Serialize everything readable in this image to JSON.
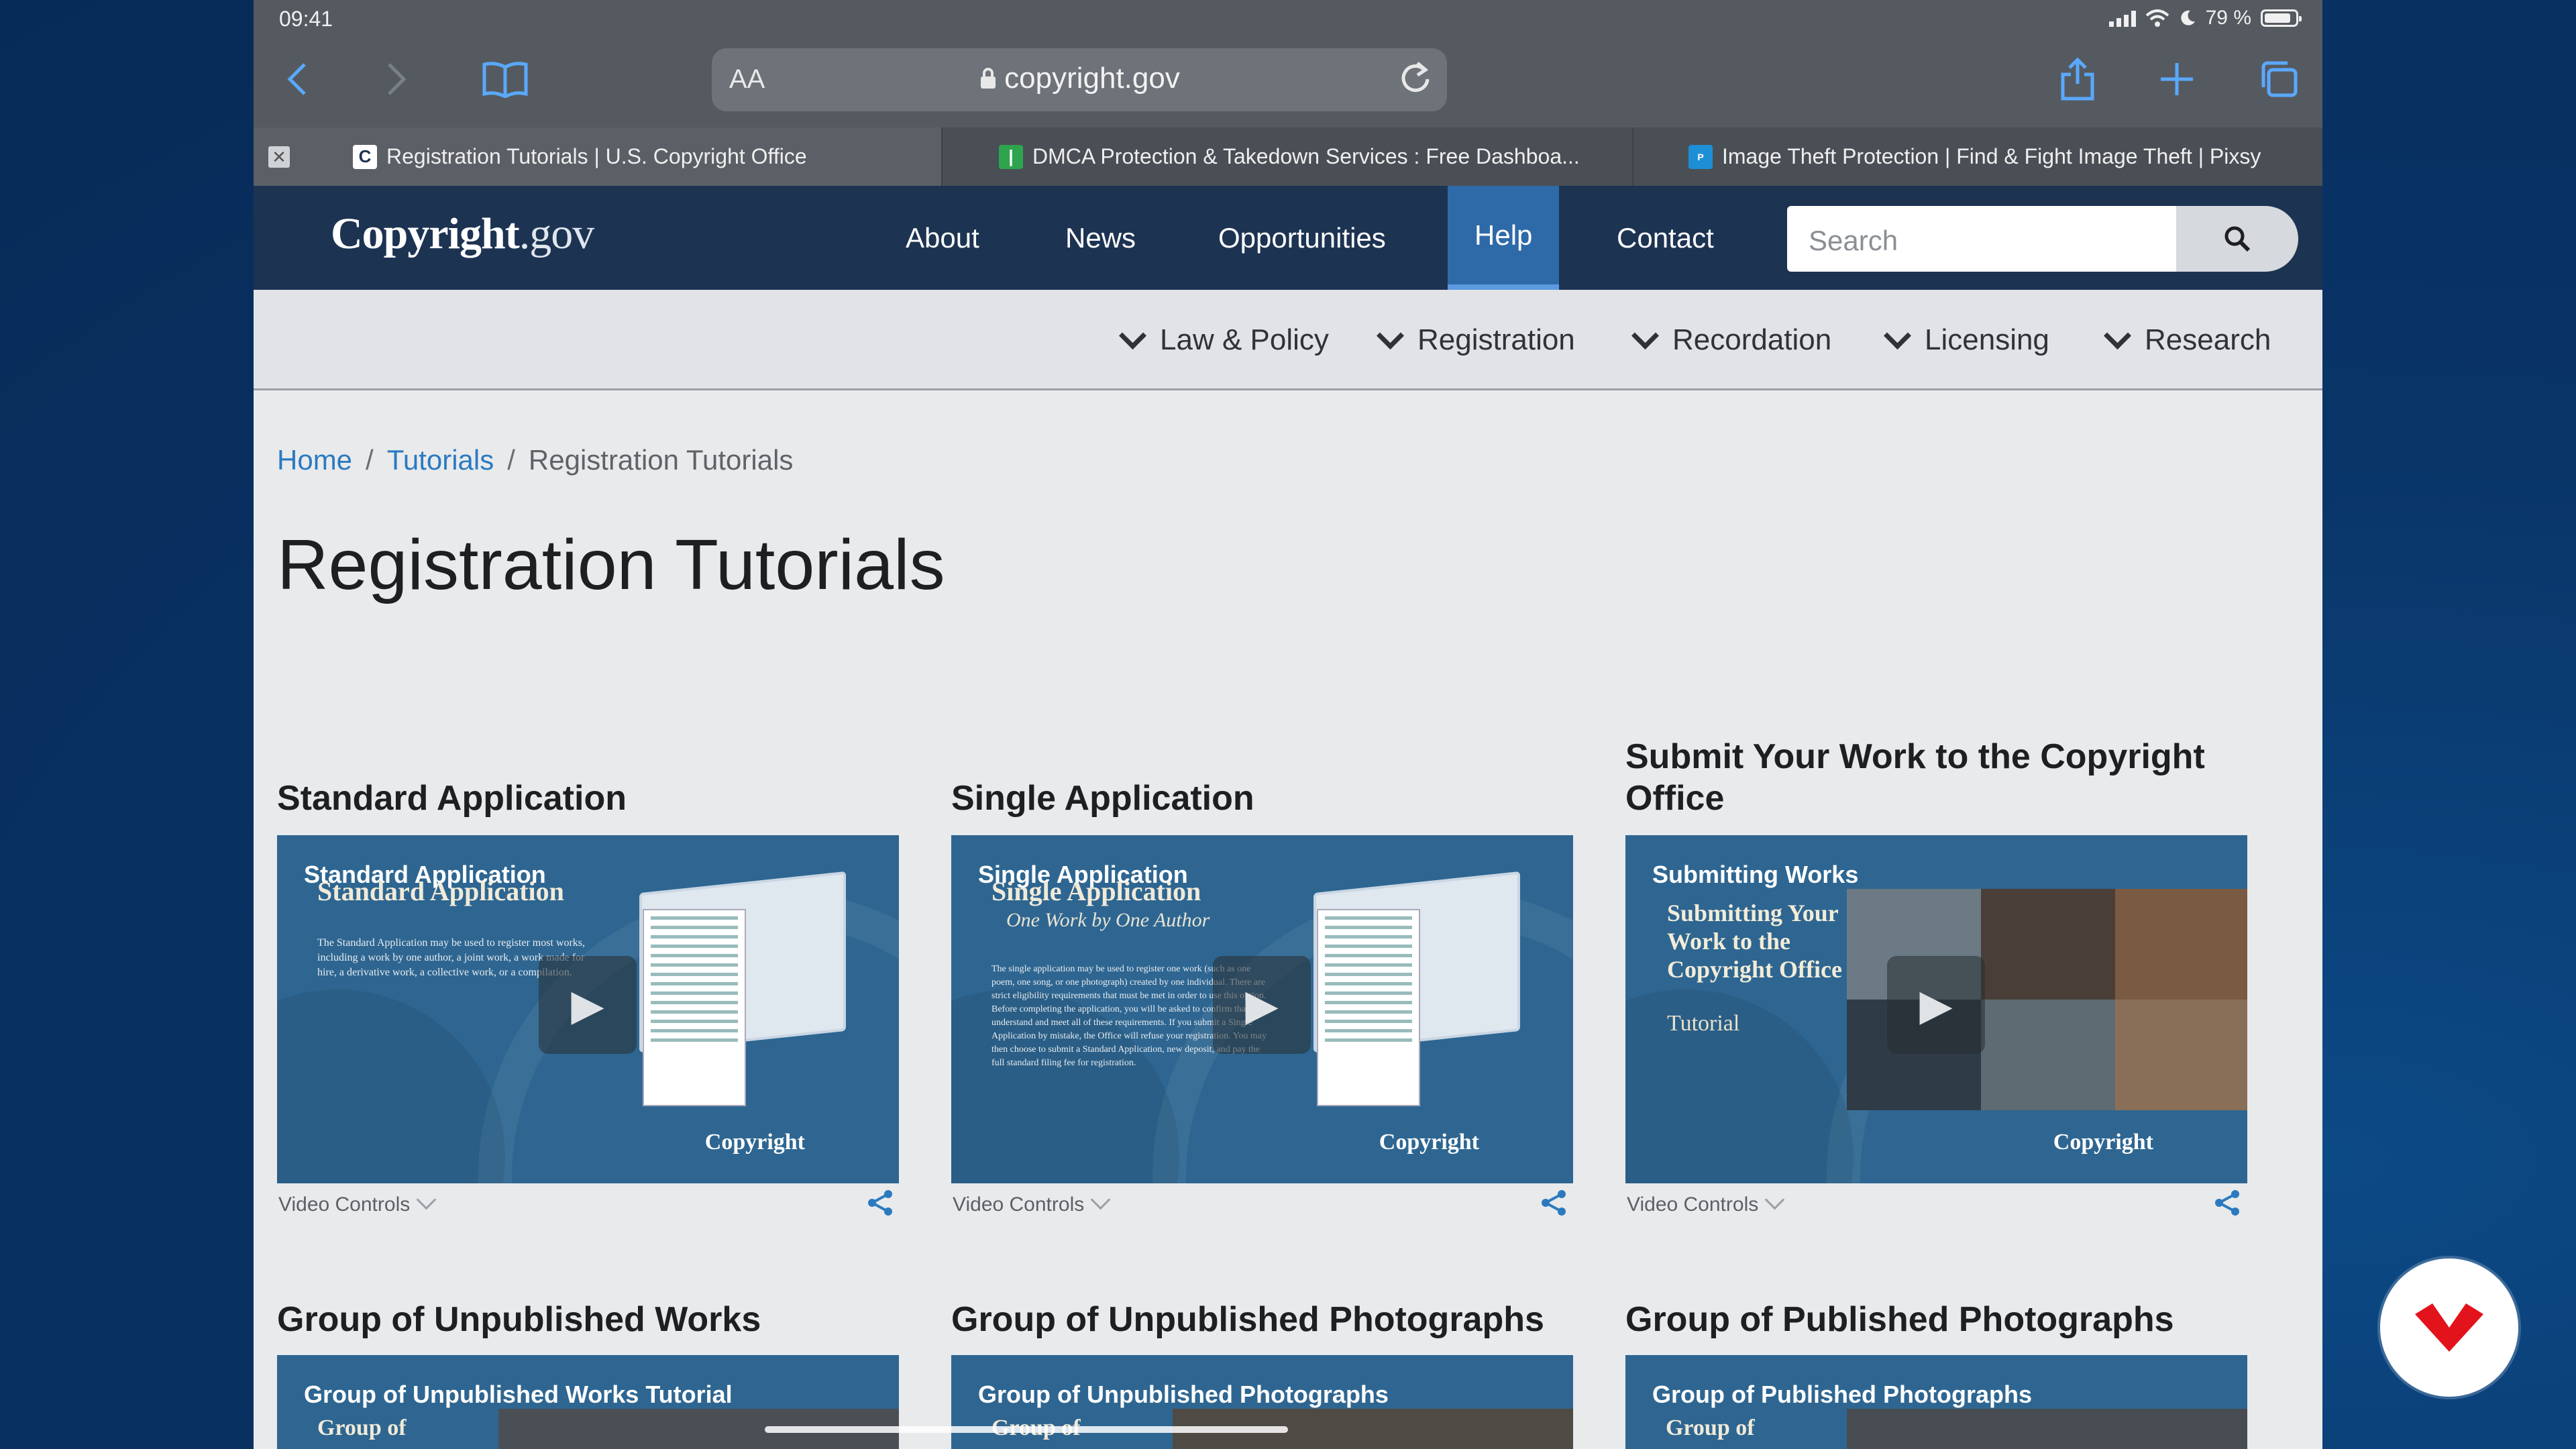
{
  "status": {
    "time": "09:41",
    "battery": "79 %"
  },
  "browser": {
    "url_aa": "AA",
    "url": "copyright.gov",
    "tabs": [
      {
        "title": "Registration Tutorials | U.S. Copyright Office",
        "active": true
      },
      {
        "title": "DMCA Protection & Takedown Services : Free Dashboa...",
        "active": false
      },
      {
        "title": "Image Theft Protection | Find & Fight Image Theft | Pixsy",
        "active": false
      }
    ]
  },
  "site": {
    "logo_main": "Copyright",
    "logo_gov": ".gov",
    "nav": [
      "About",
      "News",
      "Opportunities",
      "Help",
      "Contact"
    ],
    "active_nav": "Help",
    "search_placeholder": "Search",
    "subnav": [
      "Law & Policy",
      "Registration",
      "Recordation",
      "Licensing",
      "Research"
    ]
  },
  "breadcrumb": {
    "home": "Home",
    "tutorials": "Tutorials",
    "current": "Registration Tutorials"
  },
  "page_title": "Registration Tutorials",
  "video_controls_label": "Video Controls",
  "cards": [
    {
      "title": "Standard Application",
      "video_head": "Standard Application",
      "video_sub": "Standard Application",
      "video_body": "The Standard Application may be used to register most works, including a work by one author, a joint work, a work made for hire, a derivative work, a collective work, or a compilation.",
      "video_logo": "Copyright"
    },
    {
      "title": "Single Application",
      "video_head": "Single Application",
      "video_sub": "Single Application",
      "video_italic": "One Work by One Author",
      "video_body": "The single application may be used to register one work (such as one poem, one song, or one photograph) created by one individual. There are strict eligibility requirements that must be met in order to use this option. Before completing the application, you will be asked to confirm that you understand and meet all of these requirements. If you submit a Single Application by mistake, the Office will refuse your registration. You may then choose to submit a Standard Application, new deposit, and pay the full standard filing fee for registration.",
      "video_logo": "Copyright"
    },
    {
      "title": "Submit Your Work to the Copyright Office",
      "video_head": "Submitting Works",
      "video_serif": "Submitting Your Work to the Copyright Office",
      "video_serif_small": "Tutorial",
      "video_logo": "Copyright"
    },
    {
      "title": "Group of Unpublished Works",
      "video_head": "Group of Unpublished Works Tutorial",
      "video_sub": "Group of"
    },
    {
      "title": "Group of Unpublished Photographs",
      "video_head": "Group of Unpublished Photographs",
      "video_sub": "Group of"
    },
    {
      "title": "Group of Published Photographs",
      "video_head": "Group of Published Photographs",
      "video_sub": "Group of"
    }
  ]
}
